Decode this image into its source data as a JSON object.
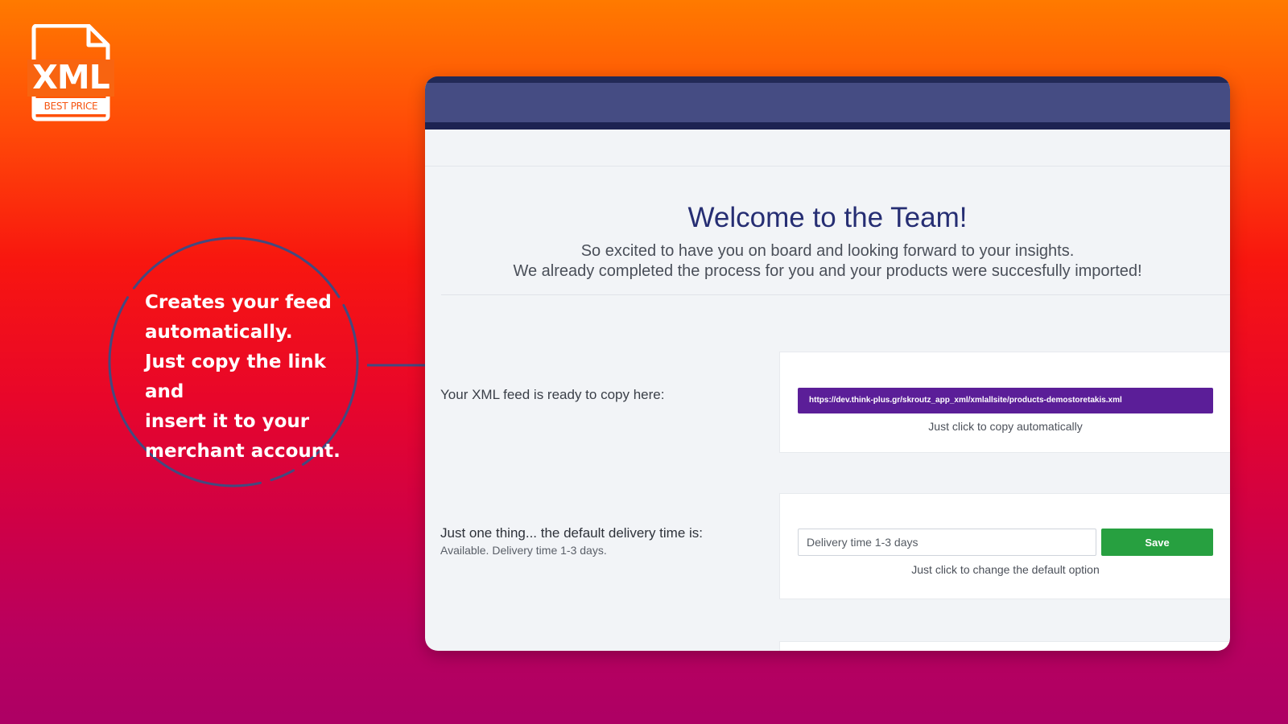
{
  "logo": {
    "main_text": "XML",
    "tag_text": "BEST PRICE"
  },
  "callout": {
    "text": "Creates your feed\nautomatically.\nJust copy the link and\ninsert it to your\nmerchant account."
  },
  "welcome": {
    "title": "Welcome to the Team!",
    "subtitle_line1": "So excited to have you on board and looking forward to your insights.",
    "subtitle_line2": "We already completed the process for you and your products were succesfully imported!"
  },
  "feed": {
    "label": "Your XML feed is ready to copy here:",
    "url": "https://dev.think-plus.gr/skroutz_app_xml/xmlallsite/products-demostoretakis.xml",
    "hint": "Just click to copy automatically"
  },
  "delivery": {
    "label": "Just one thing... the default delivery time is:",
    "sublabel": "Available. Delivery time 1-3 days.",
    "input_value": "Delivery time 1-3 days",
    "save_label": "Save",
    "hint": "Just click to change the default option"
  },
  "colors": {
    "background_top": "#ff7a00",
    "background_bottom": "#ad0064",
    "header": "#454c83",
    "title": "#262e73",
    "feed_button": "#5b1e98",
    "save_button": "#27a040",
    "accent_line": "#434a7f"
  }
}
